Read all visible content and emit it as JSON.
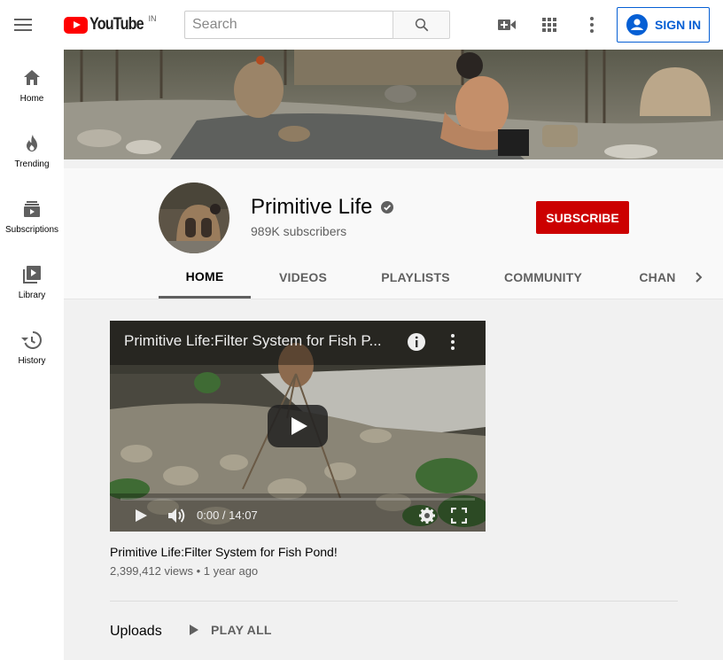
{
  "topbar": {
    "logo_text": "YouTube",
    "logo_region": "IN",
    "search_placeholder": "Search",
    "signin_label": "SIGN IN"
  },
  "sidenav": {
    "items": [
      {
        "label": "Home",
        "icon": "home-icon"
      },
      {
        "label": "Trending",
        "icon": "flame-icon"
      },
      {
        "label": "Subscriptions",
        "icon": "subscriptions-icon"
      },
      {
        "label": "Library",
        "icon": "library-icon"
      },
      {
        "label": "History",
        "icon": "history-icon"
      }
    ]
  },
  "channel": {
    "name": "Primitive Life",
    "subscribers": "989K subscribers",
    "subscribe_label": "SUBSCRIBE"
  },
  "tabs": [
    {
      "label": "HOME",
      "active": true
    },
    {
      "label": "VIDEOS"
    },
    {
      "label": "PLAYLISTS"
    },
    {
      "label": "COMMUNITY"
    },
    {
      "label": "CHAN"
    }
  ],
  "player": {
    "title": "Primitive Life:Filter System for Fish P...",
    "time": "0:00 / 14:07"
  },
  "video": {
    "title": "Primitive Life:Filter System for Fish Pond!",
    "meta": "2,399,412 views • 1 year ago"
  },
  "uploads": {
    "heading": "Uploads",
    "play_all_label": "PLAY ALL"
  },
  "colors": {
    "brand_red": "#ff0000",
    "subscribe_red": "#cc0000",
    "link_blue": "#065fd4"
  }
}
